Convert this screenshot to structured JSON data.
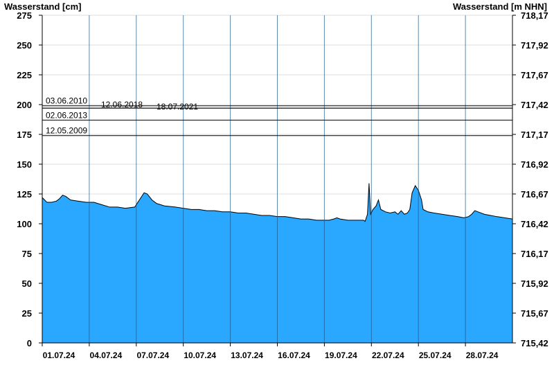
{
  "chart_data": {
    "type": "area",
    "title": "",
    "ylabel_left": "Wasserstand [cm]",
    "ylabel_right": "Wasserstand [m NHN]",
    "ylim": [
      0,
      275
    ],
    "y_ticks_left": [
      "0",
      "25",
      "50",
      "75",
      "100",
      "125",
      "150",
      "175",
      "200",
      "225",
      "250",
      "275"
    ],
    "y_ticks_right": [
      "715,42",
      "715,67",
      "715,92",
      "716,17",
      "716,42",
      "716,67",
      "716,92",
      "717,17",
      "717,42",
      "717,67",
      "717,92",
      "718,17"
    ],
    "x_day_range": [
      0,
      30
    ],
    "x_ticks": [
      {
        "day": 0,
        "label": "01.07.24"
      },
      {
        "day": 3,
        "label": "04.07.24"
      },
      {
        "day": 6,
        "label": "07.07.24"
      },
      {
        "day": 9,
        "label": "10.07.24"
      },
      {
        "day": 12,
        "label": "13.07.24"
      },
      {
        "day": 15,
        "label": "16.07.24"
      },
      {
        "day": 18,
        "label": "19.07.24"
      },
      {
        "day": 21,
        "label": "22.07.24"
      },
      {
        "day": 24,
        "label": "25.07.24"
      },
      {
        "day": 27,
        "label": "28.07.24"
      }
    ],
    "grid": true,
    "fill_color": "#2aa7ff",
    "line_color": "#000000",
    "reference_lines": [
      {
        "label": "03.06.2010",
        "value": 199
      },
      {
        "label": "12.06.2018",
        "value": 197
      },
      {
        "label": "18.07.2021",
        "value": 197
      },
      {
        "label": "02.06.2013",
        "value": 187
      },
      {
        "label": "12.05.2009",
        "value": 174
      }
    ],
    "series": [
      {
        "points": [
          [
            0,
            122
          ],
          [
            0.3,
            118
          ],
          [
            0.6,
            118
          ],
          [
            0.9,
            119
          ],
          [
            1.1,
            121
          ],
          [
            1.3,
            124
          ],
          [
            1.5,
            123
          ],
          [
            1.8,
            120
          ],
          [
            2.3,
            119
          ],
          [
            2.8,
            118
          ],
          [
            3.3,
            118
          ],
          [
            3.8,
            116
          ],
          [
            4.3,
            114
          ],
          [
            4.8,
            114
          ],
          [
            5.3,
            113
          ],
          [
            5.9,
            114
          ],
          [
            6.1,
            118
          ],
          [
            6.3,
            122
          ],
          [
            6.5,
            126
          ],
          [
            6.7,
            125
          ],
          [
            7.0,
            120
          ],
          [
            7.3,
            117
          ],
          [
            7.8,
            115
          ],
          [
            8.5,
            114
          ],
          [
            9.0,
            113
          ],
          [
            9.5,
            112
          ],
          [
            10.0,
            112
          ],
          [
            10.5,
            111
          ],
          [
            11.0,
            111
          ],
          [
            11.5,
            110
          ],
          [
            12.0,
            110
          ],
          [
            12.5,
            109
          ],
          [
            13.0,
            109
          ],
          [
            13.5,
            108
          ],
          [
            14.0,
            107
          ],
          [
            14.5,
            107
          ],
          [
            15.0,
            106
          ],
          [
            15.5,
            106
          ],
          [
            16.0,
            105
          ],
          [
            16.5,
            104
          ],
          [
            17.0,
            104
          ],
          [
            17.5,
            103
          ],
          [
            18.0,
            103
          ],
          [
            18.3,
            103
          ],
          [
            18.6,
            104
          ],
          [
            18.8,
            105
          ],
          [
            19.0,
            104
          ],
          [
            19.5,
            103
          ],
          [
            20.0,
            103
          ],
          [
            20.5,
            103
          ],
          [
            20.6,
            102
          ],
          [
            20.75,
            108
          ],
          [
            20.85,
            134
          ],
          [
            20.95,
            108
          ],
          [
            21.1,
            112
          ],
          [
            21.3,
            115
          ],
          [
            21.45,
            120
          ],
          [
            21.6,
            112
          ],
          [
            21.9,
            110
          ],
          [
            22.2,
            109
          ],
          [
            22.5,
            110
          ],
          [
            22.7,
            108
          ],
          [
            22.9,
            111
          ],
          [
            23.1,
            108
          ],
          [
            23.3,
            109
          ],
          [
            23.45,
            112
          ],
          [
            23.6,
            126
          ],
          [
            23.8,
            132
          ],
          [
            24.0,
            128
          ],
          [
            24.2,
            120
          ],
          [
            24.3,
            112
          ],
          [
            24.6,
            110
          ],
          [
            25.0,
            109
          ],
          [
            25.5,
            108
          ],
          [
            26.0,
            107
          ],
          [
            26.5,
            106
          ],
          [
            26.9,
            105
          ],
          [
            27.2,
            106
          ],
          [
            27.4,
            108
          ],
          [
            27.6,
            111
          ],
          [
            27.8,
            110
          ],
          [
            28.2,
            108
          ],
          [
            28.6,
            107
          ],
          [
            29.0,
            106
          ],
          [
            29.5,
            105
          ],
          [
            30.0,
            104
          ]
        ]
      }
    ]
  }
}
